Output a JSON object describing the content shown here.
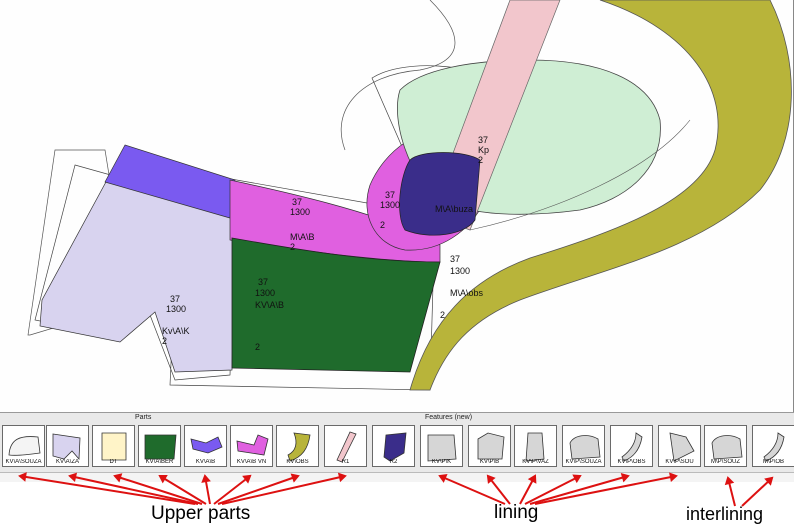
{
  "panel": {
    "parts_title": "Parts",
    "features_title": "Features (new)"
  },
  "canvas_labels": {
    "left_quarter": [
      "37",
      "1300",
      "Kv\\A\\K",
      "2"
    ],
    "vamp_green": [
      "37",
      "1300",
      "KV\\A\\B",
      "2"
    ],
    "pink_mid": [
      "37",
      "1300",
      "M\\A\\B",
      "2"
    ],
    "pink_center": [
      "37",
      "1300",
      "M\\A\\buza",
      "2"
    ],
    "dark_blue": [
      "37",
      "Kp",
      "2"
    ],
    "olive": [
      "37",
      "1300",
      "M\\A\\obs",
      "2"
    ]
  },
  "upper_tiles": [
    {
      "label": "KV\\A\\SOUZA",
      "fill": "#f4f4f4",
      "icon": "upper-souza-icon"
    },
    {
      "label": "KV\\A\\ZA",
      "fill": "#d8d3ef",
      "icon": "upper-za-icon"
    },
    {
      "label": "DT",
      "fill": "#fff4c8",
      "icon": "upper-dt-icon"
    },
    {
      "label": "KV\\A\\BER",
      "fill": "#1f6b2c",
      "icon": "upper-ber-icon"
    },
    {
      "label": "KV\\A\\B",
      "fill": "#7a5af0",
      "icon": "upper-b-icon"
    },
    {
      "label": "KV\\A\\B VN",
      "fill": "#e060e0",
      "icon": "upper-bvn-icon"
    },
    {
      "label": "KV\\OBS",
      "fill": "#b8b43a",
      "icon": "upper-obs-icon"
    },
    {
      "label": "R1",
      "fill": "#f2c6cc",
      "icon": "upper-r1-icon"
    },
    {
      "label": "R2",
      "fill": "#3a2d8a",
      "icon": "upper-r2-icon"
    }
  ],
  "lining_tiles": [
    {
      "label": "KV\\P\\K",
      "icon": "lining-k-icon"
    },
    {
      "label": "KV\\P\\B",
      "icon": "lining-b-icon"
    },
    {
      "label": "KV\\P\\VAZ",
      "icon": "lining-vaz-icon"
    },
    {
      "label": "KV\\P\\SOUZA",
      "icon": "lining-souza-icon"
    },
    {
      "label": "KV\\P\\OBS",
      "icon": "lining-obs-icon"
    },
    {
      "label": "KV\\P\\SOU",
      "icon": "lining-sou-icon"
    }
  ],
  "interlining_tiles": [
    {
      "label": "M\\P\\SOUZ",
      "icon": "interlining-souz-icon"
    },
    {
      "label": "M\\P\\OB",
      "icon": "interlining-ob-icon"
    }
  ],
  "annotations": {
    "upper": "Upper parts",
    "lining": "lining",
    "interlining": "interlining"
  },
  "colors": {
    "annotation_arrow": "#dd1111",
    "lavender": "#d8d3ef",
    "violet": "#7a5af0",
    "magenta": "#e060e0",
    "green": "#1f6b2c",
    "olive": "#b8b43a",
    "light_green": "#cfeed4",
    "pink": "#f2c6cc",
    "dark_blue": "#3a2d8a"
  }
}
